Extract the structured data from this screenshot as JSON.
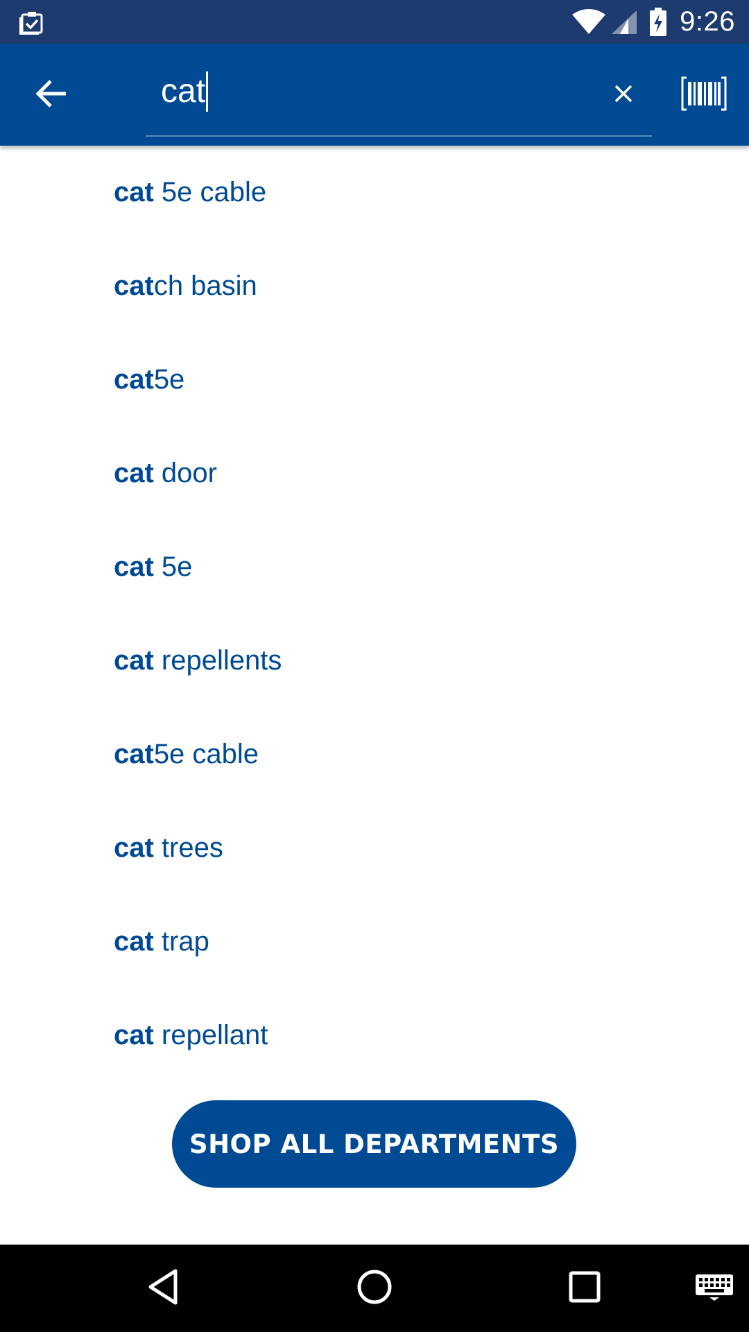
{
  "status_bar": {
    "time": "9:26",
    "left_icon": "clipboard-check-icon",
    "icons": [
      "wifi-icon",
      "cell-signal-icon",
      "battery-charging-icon"
    ]
  },
  "app_bar": {
    "back_icon": "arrow-left-icon",
    "search_value": "cat",
    "clear_icon": "close-icon",
    "barcode_icon": "barcode-scan-icon"
  },
  "suggestions": [
    {
      "match": "cat",
      "rest": " 5e cable"
    },
    {
      "match": "cat",
      "rest": "ch basin"
    },
    {
      "match": "cat",
      "rest": "5e"
    },
    {
      "match": "cat",
      "rest": " door"
    },
    {
      "match": "cat",
      "rest": " 5e"
    },
    {
      "match": "cat",
      "rest": " repellents"
    },
    {
      "match": "cat",
      "rest": "5e cable"
    },
    {
      "match": "cat",
      "rest": " trees"
    },
    {
      "match": "cat",
      "rest": " trap"
    },
    {
      "match": "cat",
      "rest": " repellant"
    }
  ],
  "shop_all_label": "SHOP ALL DEPARTMENTS",
  "nav_bar": {
    "icons": [
      "nav-back-icon",
      "nav-home-icon",
      "nav-recents-icon",
      "keyboard-icon"
    ]
  },
  "colors": {
    "status_bar": "#1d3b6e",
    "brand_blue": "#004a93",
    "nav_bar": "#000000"
  }
}
